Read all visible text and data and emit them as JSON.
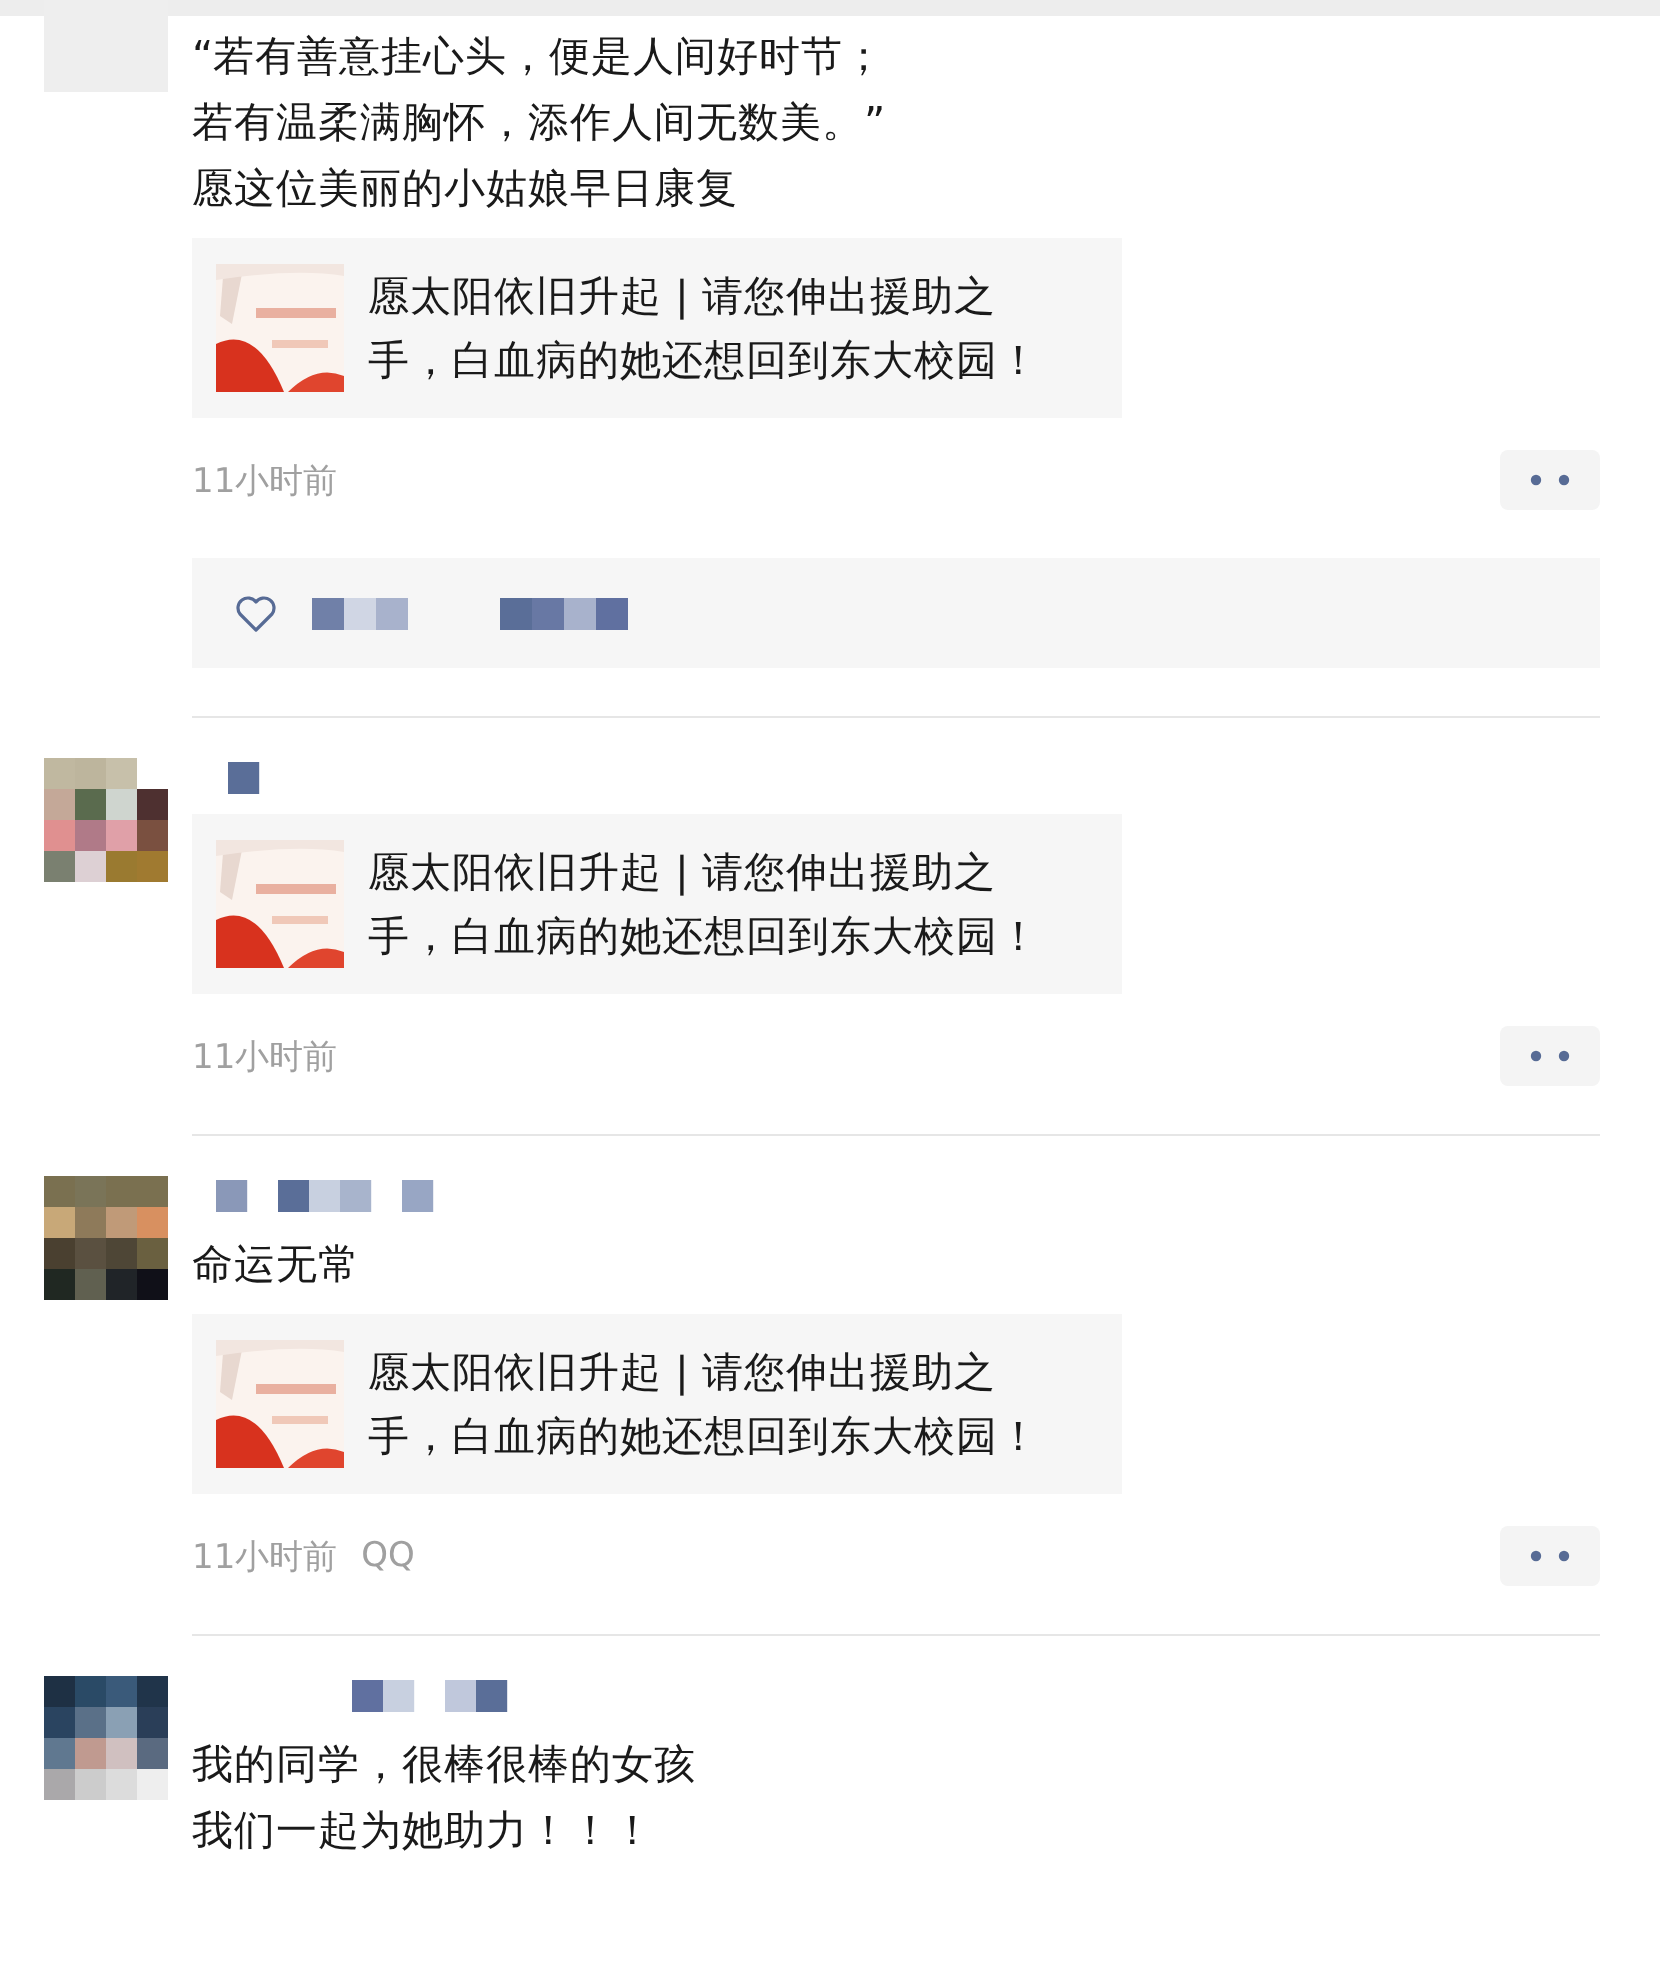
{
  "posts": [
    {
      "text_lines": [
        "“若有善意挂心头，便是人间好时节；",
        "若有温柔满胸怀，添作人间无数美。”",
        "愿这位美丽的小姑娘早日康复"
      ],
      "link": {
        "title": "愿太阳依旧升起 | 请您伸出援助之手，白血病的她还想回到东大校园！"
      },
      "time": "11小时前",
      "has_likes": true
    },
    {
      "link": {
        "title": "愿太阳依旧升起 | 请您伸出援助之手，白血病的她还想回到东大校园！"
      },
      "time": "11小时前",
      "has_likes": false
    },
    {
      "text_lines": [
        "命运无常"
      ],
      "link": {
        "title": "愿太阳依旧升起 | 请您伸出援助之手，白血病的她还想回到东大校园！"
      },
      "time": "11小时前",
      "source": "QQ",
      "has_likes": false
    },
    {
      "text_lines": [
        "我的同学，很棒很棒的女孩",
        "我们一起为她助力！！！"
      ],
      "has_likes": false
    }
  ]
}
